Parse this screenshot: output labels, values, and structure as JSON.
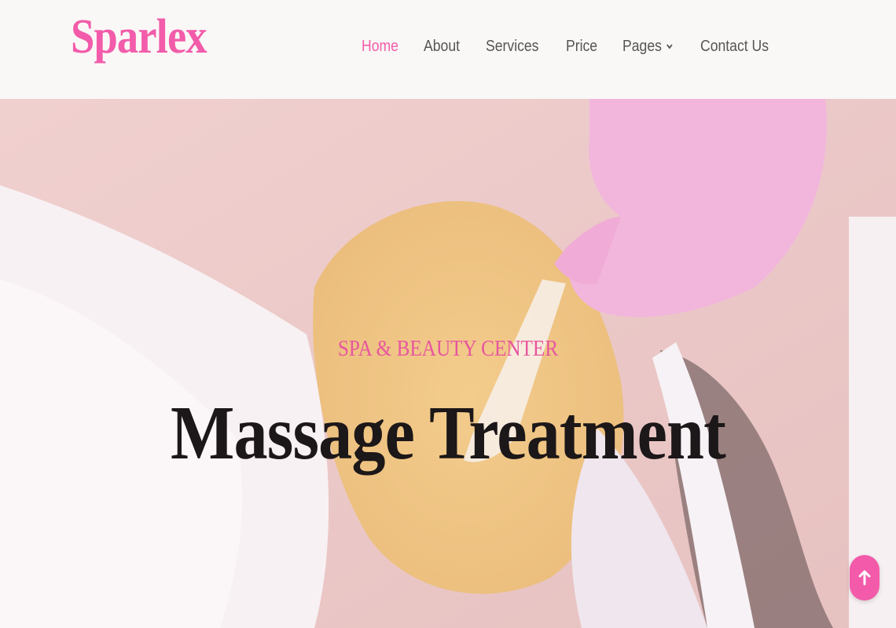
{
  "brand": {
    "logo_text": "Sparlex",
    "accent_color": "#f25caa"
  },
  "nav": {
    "items": [
      {
        "label": "Home",
        "active": true
      },
      {
        "label": "About",
        "active": false
      },
      {
        "label": "Services",
        "active": false
      },
      {
        "label": "Price",
        "active": false
      },
      {
        "label": "Pages",
        "active": false,
        "has_dropdown": true,
        "icon": "chevron-down-icon"
      },
      {
        "label": "Contact Us",
        "active": false
      }
    ]
  },
  "hero": {
    "subtitle": "SPA & BEAUTY CENTER",
    "title": "Massage Treatment",
    "image_subject": "facial mask spa treatment background"
  },
  "back_to_top": {
    "icon": "arrow-up-icon",
    "color": "#f35aa9"
  }
}
